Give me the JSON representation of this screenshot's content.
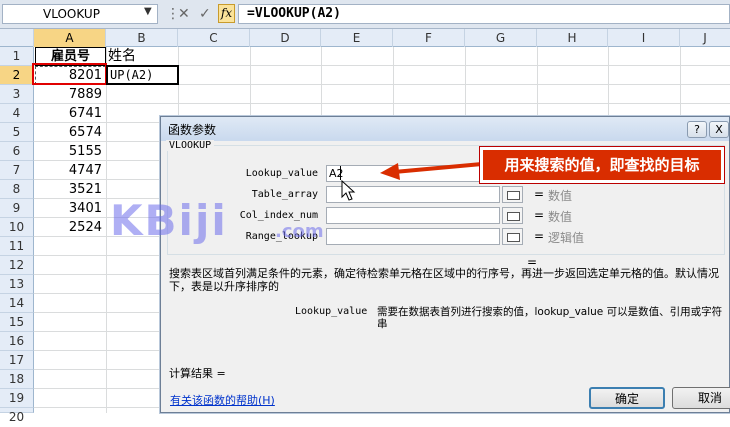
{
  "formula_bar": {
    "name_box": "VLOOKUP",
    "fx_label": "fx",
    "formula": "=VLOOKUP(A2)"
  },
  "columns": [
    "A",
    "B",
    "C",
    "D",
    "E",
    "F",
    "G",
    "H",
    "I",
    "J"
  ],
  "rows": [
    "1",
    "2",
    "3",
    "4",
    "5",
    "6",
    "7",
    "8",
    "9",
    "10",
    "11",
    "12",
    "13",
    "14",
    "15",
    "16",
    "17",
    "18",
    "19",
    "20"
  ],
  "cells": {
    "a1": "雇员号",
    "b1": "姓名",
    "b2": "UP(A2)",
    "a_values": [
      "8201",
      "7889",
      "6741",
      "6574",
      "5155",
      "4747",
      "3521",
      "3401",
      "2524"
    ]
  },
  "dialog": {
    "title": "函数参数",
    "help_btn": "?",
    "close_btn": "X",
    "function_name": "VLOOKUP",
    "args": [
      {
        "label": "Lookup_value",
        "value": "A2",
        "result": "",
        "hint": ""
      },
      {
        "label": "Table_array",
        "value": "",
        "result": "=",
        "hint": "数值"
      },
      {
        "label": "Col_index_num",
        "value": "",
        "result": "=",
        "hint": "数值"
      },
      {
        "label": "Range_lookup",
        "value": "",
        "result": "=",
        "hint": "逻辑值"
      }
    ],
    "overall_eq": "=",
    "description": "搜索表区域首列满足条件的元素，确定待检索单元格在区域中的行序号，再进一步返回选定单元格的值。默认情况下，表是以升序排序的",
    "arg_desc_name": "Lookup_value",
    "arg_desc_text": "需要在数据表首列进行搜索的值，lookup_value 可以是数值、引用或字符串",
    "result_label": "计算结果 =",
    "help_link": "有关该函数的帮助(H)",
    "ok": "确定",
    "cancel": "取消"
  },
  "callout": "用来搜索的值，即查找的目标",
  "watermark": {
    "main": "KBiji",
    "suffix": ".com"
  },
  "colors": {
    "callout": "#d92d00",
    "highlight_border": "#e00000",
    "accent": "#f7d585"
  }
}
